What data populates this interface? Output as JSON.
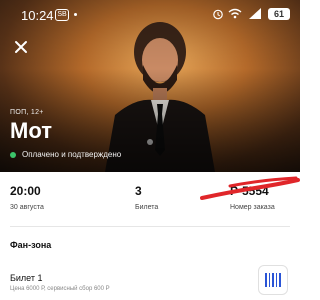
{
  "status_bar": {
    "time": "10:24",
    "app_badge": "SB",
    "battery": "61"
  },
  "event": {
    "genre_age": "ПОП, 12+",
    "artist": "Мот",
    "payment_status": "Оплачено и подтверждено",
    "status_color": "#3cc46a"
  },
  "details": {
    "time": "20:00",
    "date": "30 августа",
    "ticket_count": "3",
    "ticket_count_label": "Билета",
    "order_number": "Р-5554",
    "order_label": "Номер заказа"
  },
  "section": {
    "title": "Фан-зона"
  },
  "ticket": {
    "title": "Билет 1",
    "price_line": "Цена 6000 Р, сервисный сбор 600 Р"
  },
  "icons": [
    "close-icon",
    "barcode-icon",
    "wifi-icon",
    "alarm-icon",
    "signal-icon"
  ]
}
